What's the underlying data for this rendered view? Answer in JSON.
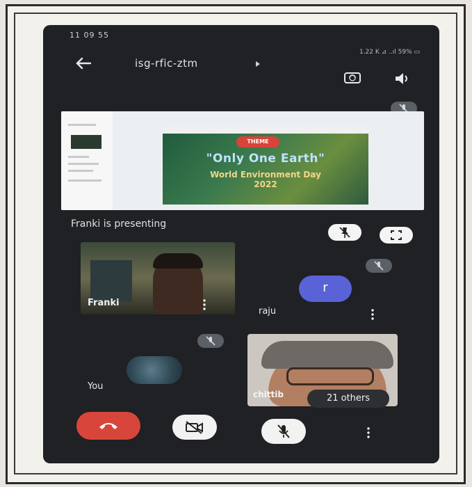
{
  "status_bar": {
    "time": "11 09 55",
    "indicators": "1.22 K ⊿ ..ıl 59% ▭"
  },
  "header": {
    "back_icon": "arrow-left-icon",
    "meeting_code": "isg-rfic-ztm",
    "flip_camera_icon": "flip-camera-icon",
    "speaker_icon": "speaker-icon"
  },
  "presentation": {
    "theme_badge": "THEME",
    "headline": "\"Only One Earth\"",
    "subtitle_line1": "World Environment Day",
    "subtitle_line2": "2022",
    "presenter_label": "Franki is presenting",
    "pin_icon": "pin-off-icon",
    "fullscreen_icon": "fullscreen-icon"
  },
  "participants": [
    {
      "name": "Franki",
      "type": "video"
    },
    {
      "name": "raju",
      "type": "avatar",
      "initial": "r",
      "avatar_color": "#5a62d8",
      "muted": true
    },
    {
      "name": "You",
      "type": "avatar",
      "muted": true
    },
    {
      "name": "chittib",
      "type": "video"
    }
  ],
  "others_badge": "21 others",
  "controls": {
    "end_call_icon": "end-call-icon",
    "camera_icon": "camera-off-icon",
    "mic_icon": "mic-off-icon",
    "more_icon": "more-vertical-icon",
    "end_call_color": "#d8453b"
  }
}
